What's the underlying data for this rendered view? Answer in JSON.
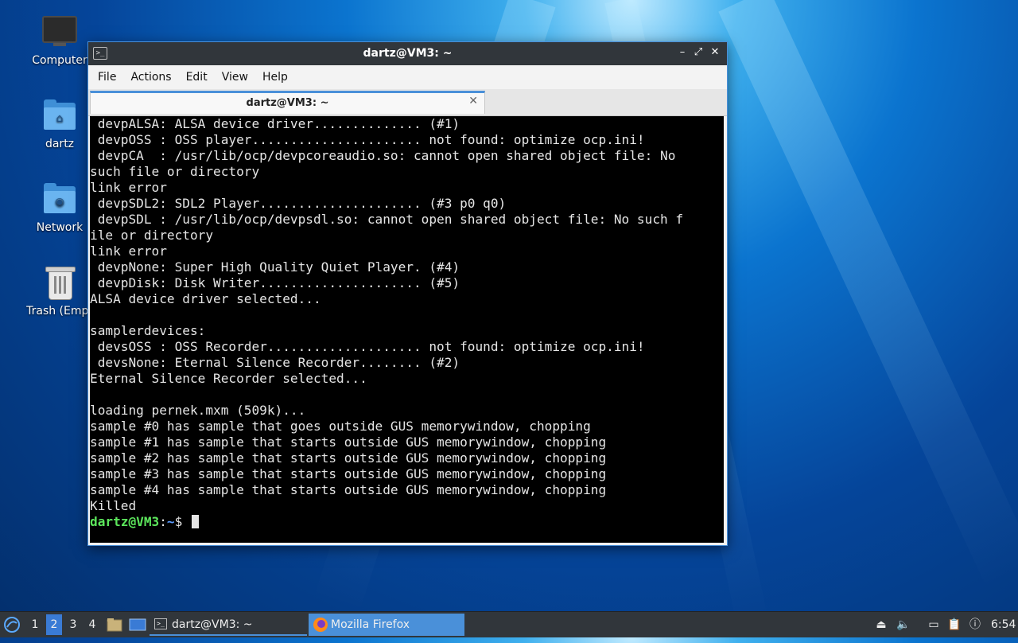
{
  "desktop": {
    "icons": [
      {
        "label": "Computer"
      },
      {
        "label": "dartz"
      },
      {
        "label": "Network"
      },
      {
        "label": "Trash (Empt"
      }
    ]
  },
  "window": {
    "title": "dartz@VM3: ~",
    "controls": {
      "minimize": "–",
      "maximize": "⤢",
      "close": "✕"
    },
    "menu": [
      "File",
      "Actions",
      "Edit",
      "View",
      "Help"
    ],
    "tab": {
      "label": "dartz@VM3: ~",
      "close": "✕"
    },
    "terminal": {
      "lines": [
        " devpALSA: ALSA device driver.............. (#1)",
        " devpOSS : OSS player...................... not found: optimize ocp.ini!",
        " devpCA  : /usr/lib/ocp/devpcoreaudio.so: cannot open shared object file: No",
        "such file or directory",
        "link error",
        " devpSDL2: SDL2 Player..................... (#3 p0 q0)",
        " devpSDL : /usr/lib/ocp/devpsdl.so: cannot open shared object file: No such f",
        "ile or directory",
        "link error",
        " devpNone: Super High Quality Quiet Player. (#4)",
        " devpDisk: Disk Writer..................... (#5)",
        "ALSA device driver selected...",
        "",
        "samplerdevices:",
        " devsOSS : OSS Recorder.................... not found: optimize ocp.ini!",
        " devsNone: Eternal Silence Recorder........ (#2)",
        "Eternal Silence Recorder selected...",
        "",
        "loading pernek.mxm (509k)...",
        "sample #0 has sample that goes outside GUS memorywindow, chopping",
        "sample #1 has sample that starts outside GUS memorywindow, chopping",
        "sample #2 has sample that starts outside GUS memorywindow, chopping",
        "sample #3 has sample that starts outside GUS memorywindow, chopping",
        "sample #4 has sample that starts outside GUS memorywindow, chopping",
        "Killed"
      ],
      "prompt_user": "dartz@VM3",
      "prompt_sep": ":",
      "prompt_path": "~",
      "prompt_symbol": "$ "
    }
  },
  "taskbar": {
    "workspaces": [
      "1",
      "2",
      "3",
      "4"
    ],
    "active_workspace": "2",
    "tasks": [
      {
        "label": "dartz@VM3: ~"
      },
      {
        "label": "Mozilla Firefox"
      }
    ],
    "clock": "6:54"
  }
}
